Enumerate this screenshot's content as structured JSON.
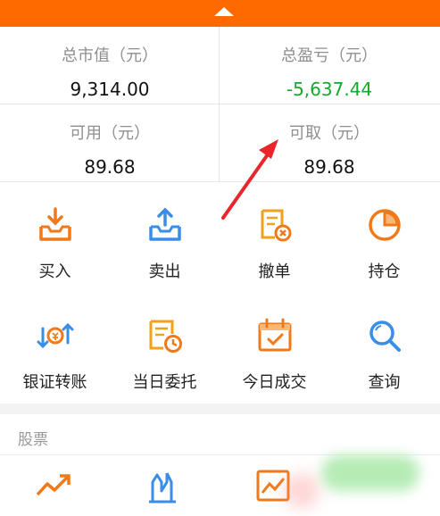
{
  "header": {
    "collapse_icon": "caret-up-icon"
  },
  "account": {
    "total_market_value": {
      "label": "总市值（元）",
      "value": "9,314.00"
    },
    "total_profit_loss": {
      "label": "总盈亏（元）",
      "value": "-5,637.44"
    },
    "available": {
      "label": "可用（元）",
      "value": "89.68"
    },
    "withdrawable": {
      "label": "可取（元）",
      "value": "89.68"
    }
  },
  "actions": [
    {
      "label": "买入",
      "icon": "buy-tray-icon"
    },
    {
      "label": "卖出",
      "icon": "sell-tray-icon"
    },
    {
      "label": "撤单",
      "icon": "cancel-order-icon"
    },
    {
      "label": "持仓",
      "icon": "position-pie-icon"
    },
    {
      "label": "银证转账",
      "icon": "bank-transfer-icon"
    },
    {
      "label": "当日委托",
      "icon": "today-order-icon"
    },
    {
      "label": "今日成交",
      "icon": "today-deal-icon"
    },
    {
      "label": "查询",
      "icon": "search-icon"
    }
  ],
  "stock_section": {
    "title": "股票",
    "icons": [
      "trend-up-icon",
      "candlestick-icon",
      "chart-frame-icon"
    ]
  },
  "colors": {
    "accent": "#ff6a00",
    "negative": "#16a82d",
    "icon_orange": "#f07a1a",
    "icon_blue": "#3a8de8",
    "arrow": "#e8262b"
  }
}
